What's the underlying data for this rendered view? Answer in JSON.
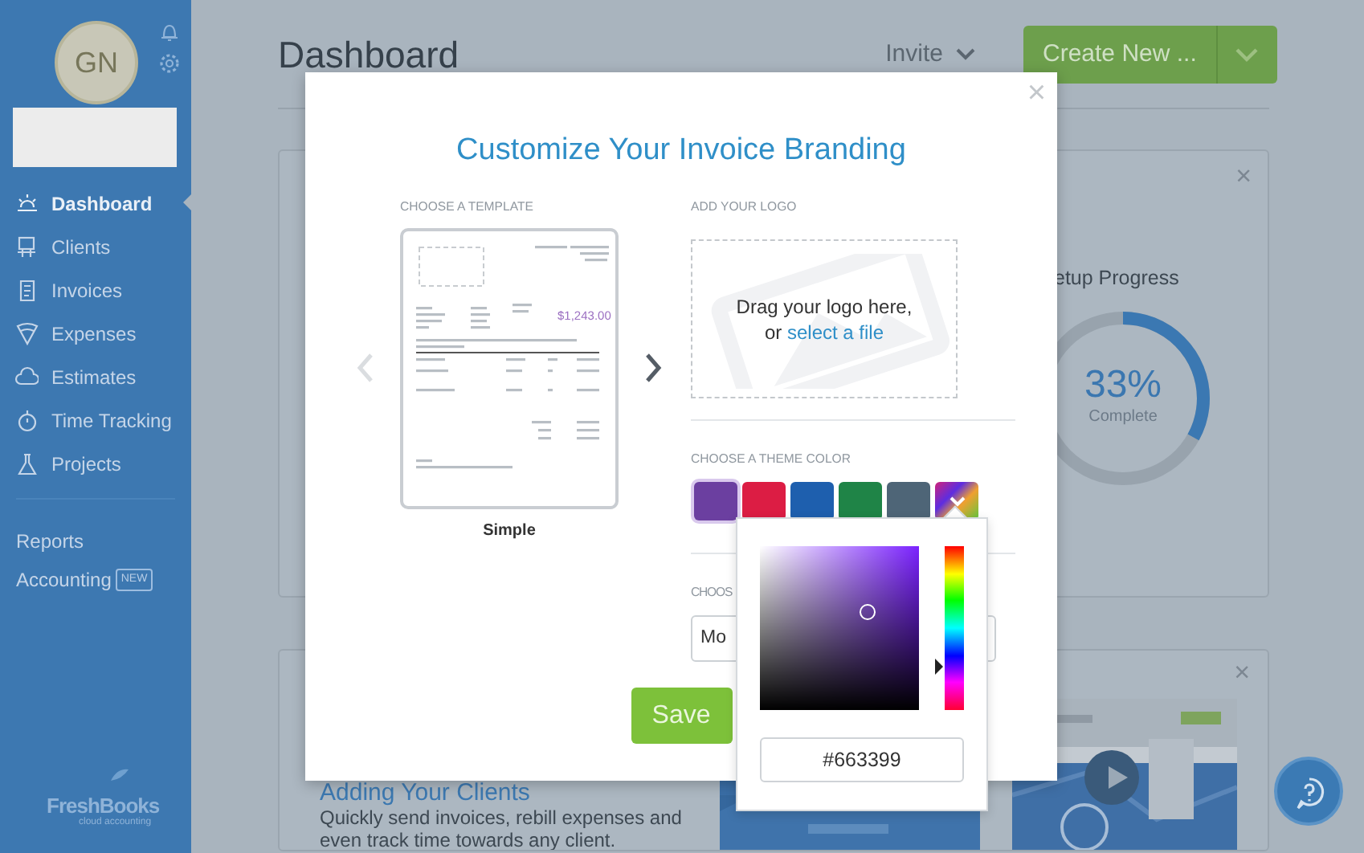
{
  "sidebar": {
    "avatar_initials": "GN",
    "nav": [
      {
        "label": "Dashboard",
        "selected": true
      },
      {
        "label": "Clients",
        "selected": false
      },
      {
        "label": "Invoices",
        "selected": false
      },
      {
        "label": "Expenses",
        "selected": false
      },
      {
        "label": "Estimates",
        "selected": false
      },
      {
        "label": "Time Tracking",
        "selected": false
      },
      {
        "label": "Projects",
        "selected": false
      }
    ],
    "links": [
      {
        "label": "Reports"
      },
      {
        "label": "Accounting",
        "badge": "NEW"
      }
    ],
    "logo": {
      "name": "FreshBooks",
      "tagline": "cloud accounting"
    }
  },
  "header": {
    "title": "Dashboard",
    "invite": "Invite",
    "create_button": "Create New ..."
  },
  "setup_card": {
    "close": "×",
    "title": "etup Progress",
    "percent": "33%",
    "caption": "Complete",
    "level": 0.33
  },
  "clients_card": {
    "close": "×",
    "title": "Adding Your Clients",
    "text": "Quickly send invoices, rebill expenses and even track time towards any client."
  },
  "modal": {
    "close": "×",
    "title": "Customize Your Invoice Branding",
    "template": {
      "label": "CHOOSE A TEMPLATE",
      "name": "Simple",
      "amount": "$1,243.00",
      "prev_disabled": true
    },
    "logo": {
      "label": "ADD YOUR LOGO",
      "drop_text": "Drag your logo here,",
      "drop_or": "or",
      "drop_link": "select a file"
    },
    "theme": {
      "label": "CHOOSE A THEME COLOR",
      "swatches": [
        {
          "kind": "solid",
          "color": "#6b3fa0",
          "selected": true
        },
        {
          "kind": "solid",
          "color": "#dc1d44",
          "selected": false
        },
        {
          "kind": "solid",
          "color": "#1e5fae",
          "selected": false
        },
        {
          "kind": "solid",
          "color": "#1f8447",
          "selected": false
        },
        {
          "kind": "solid",
          "color": "#4e6577",
          "selected": false
        },
        {
          "kind": "custom",
          "selected": false
        }
      ]
    },
    "font": {
      "label": "CHOOS",
      "value": "Mo"
    },
    "save": "Save"
  },
  "color_picker": {
    "hex": "#663399"
  }
}
